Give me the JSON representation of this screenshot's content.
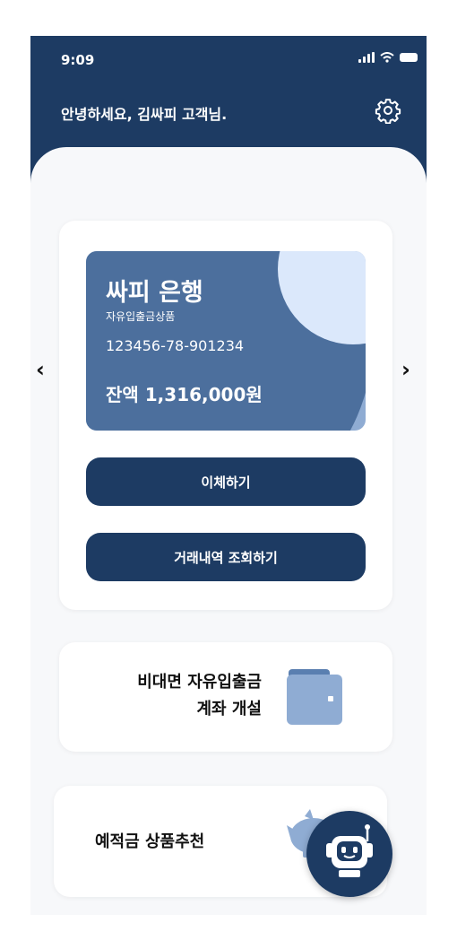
{
  "status_bar": {
    "time": "9:09",
    "icons": [
      "signal-icon",
      "wifi-icon",
      "battery-icon"
    ]
  },
  "header": {
    "greeting": "안녕하세요, 김싸피 고객님.",
    "settings_icon": "gear-icon"
  },
  "account": {
    "bank_name": "싸피 은행",
    "product": "자유입출금상품",
    "number": "123456-78-901234",
    "balance": "잔액 1,316,000원"
  },
  "nav": {
    "prev_label": "‹",
    "next_label": "›"
  },
  "actions": {
    "transfer": "이체하기",
    "history": "거래내역 조회하기"
  },
  "open_account": {
    "line1": "비대면 자유입출금",
    "line2": "계좌 개설",
    "icon": "wallet-icon"
  },
  "recommend": {
    "label": "예적금 상품추천",
    "icon": "piggy-bank-icon"
  },
  "chatbot": {
    "icon": "robot-icon"
  },
  "colors": {
    "primary": "#1d3b63",
    "card_dark": "#4c6f9d",
    "card_mid": "#8facd3",
    "card_light": "#dbe8fb",
    "background": "#f7f8fa"
  }
}
